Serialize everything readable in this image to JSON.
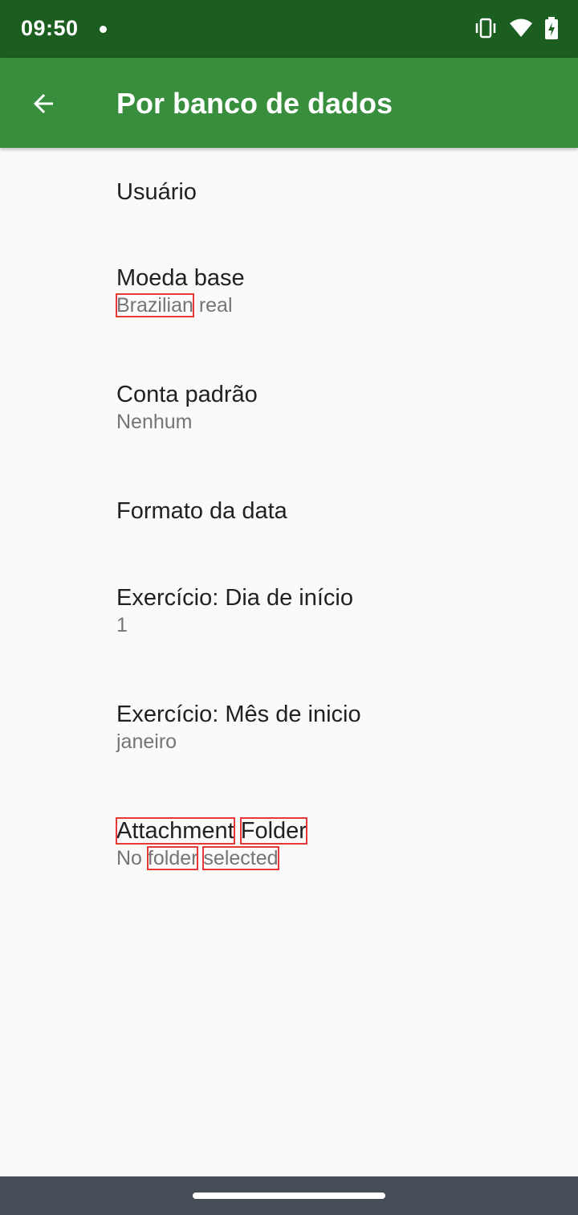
{
  "status_bar": {
    "time": "09:50"
  },
  "app_bar": {
    "title": "Por banco de dados"
  },
  "preferences": [
    {
      "title": "Usuário",
      "summary": ""
    },
    {
      "title": "Moeda base",
      "summary_words": [
        "Brazilian",
        "real"
      ]
    },
    {
      "title": "Conta padrão",
      "summary": "Nenhum"
    },
    {
      "title": "Formato da data",
      "summary": ""
    },
    {
      "title": "Exercício: Dia de início",
      "summary": "1"
    },
    {
      "title": "Exercício: Mês de inicio",
      "summary": "janeiro"
    },
    {
      "title_words": [
        "Attachment",
        "Folder"
      ],
      "summary_words": [
        "No",
        "folder",
        "selected"
      ]
    }
  ],
  "colors": {
    "status_bar": "#1b5e20",
    "app_bar": "#388e3c",
    "background": "#fafafa",
    "highlight_box": "#e53935"
  }
}
